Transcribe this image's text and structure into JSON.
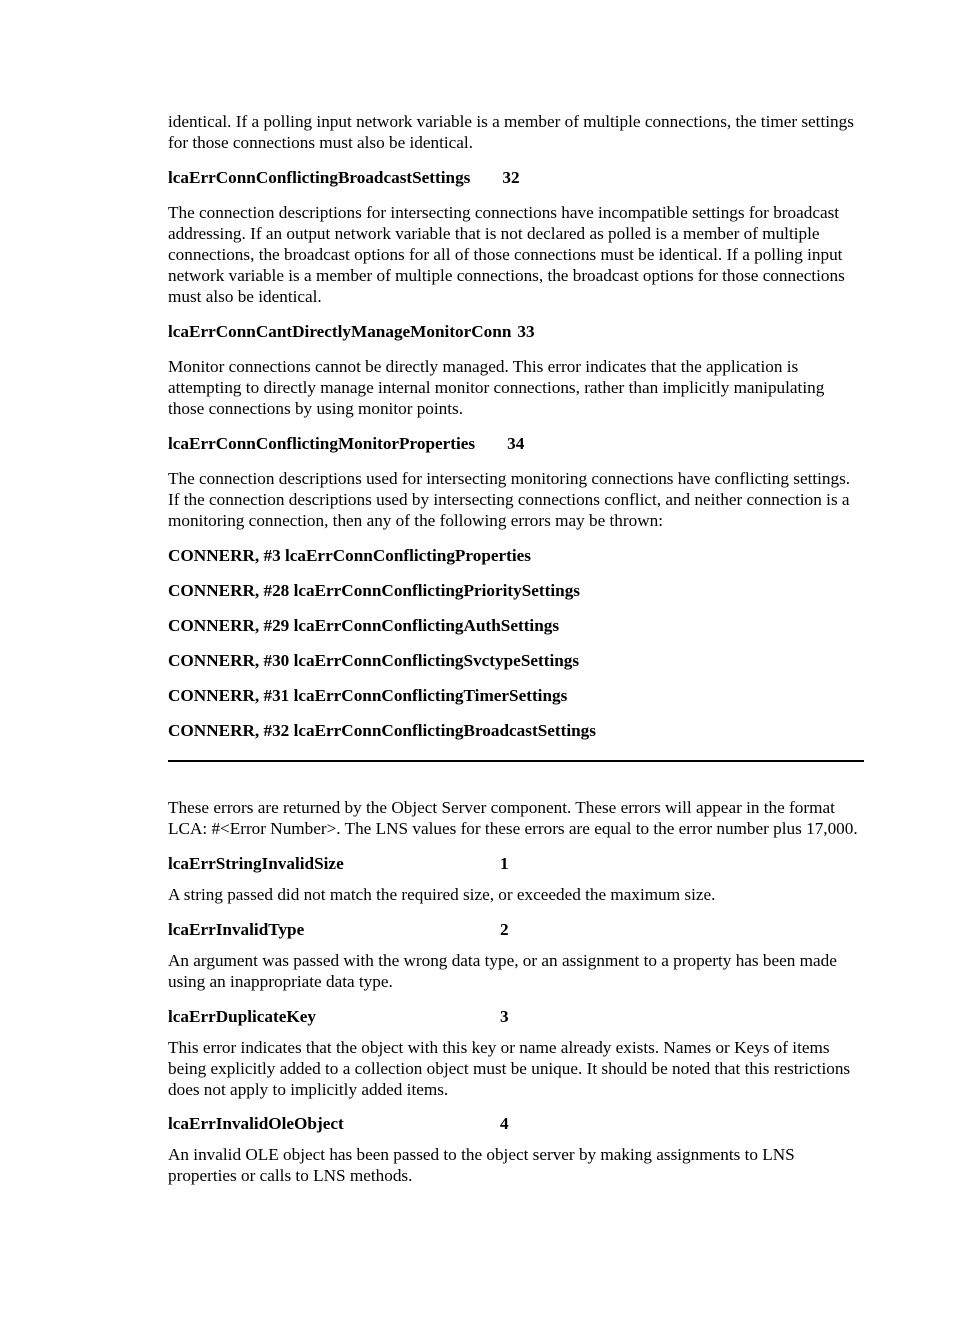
{
  "top": {
    "p1": "identical.  If a polling input network variable is a member of multiple connections, the timer settings for those connections must also be identical.",
    "h1_label": "lcaErrConnConflictingBroadcastSettings",
    "h1_num": "32",
    "p2": "The connection descriptions for intersecting connections have incompatible settings for broadcast addressing.  If an output network variable that is not declared as polled is a member of multiple connections, the broadcast options for all of those connections must be identical.  If a polling input network variable is a member of multiple connections, the broadcast options for those connections must also be identical.",
    "h2_label": "lcaErrConnCantDirectlyManageMonitorConn",
    "h2_num": "33",
    "p3": "Monitor connections cannot be directly managed.  This error indicates that the application is attempting to directly manage internal monitor connections, rather than implicitly manipulating those connections by using monitor points.",
    "h3_label": "lcaErrConnConflictingMonitorProperties",
    "h3_num": "34",
    "p4": "The connection descriptions used for intersecting monitoring connections have conflicting settings. If the connection descriptions used by intersecting connections conflict, and neither connection is a monitoring connection, then any of the following errors may be thrown:",
    "list": [
      "CONNERR, #3 lcaErrConnConflictingProperties",
      "CONNERR, #28 lcaErrConnConflictingPrioritySettings",
      "CONNERR, #29 lcaErrConnConflictingAuthSettings",
      "CONNERR, #30 lcaErrConnConflictingSvctypeSettings",
      "CONNERR, #31 lcaErrConnConflictingTimerSettings",
      "CONNERR, #32 lcaErrConnConflictingBroadcastSettings"
    ]
  },
  "bottom": {
    "intro": "These errors are returned by the Object Server component. These errors will appear in the format LCA: #<Error Number>. The LNS values for these errors are equal to the error number plus 17,000.",
    "items": [
      {
        "label": "lcaErrStringInvalidSize",
        "num": "1",
        "desc": "A string passed did not match the required size, or exceeded the maximum size."
      },
      {
        "label": "lcaErrInvalidType",
        "num": "2",
        "desc": "An argument was passed with the wrong data type, or an assignment to a property has been made using an inappropriate data type."
      },
      {
        "label": "lcaErrDuplicateKey",
        "num": "3",
        "desc": "This error indicates that the object with this key or name already exists. Names or Keys of items being explicitly added to a collection object must be unique. It should be noted that this restrictions does not apply to implicitly added items."
      },
      {
        "label": "lcaErrInvalidOleObject",
        "num": "4",
        "desc": "An invalid OLE object has been passed to the object server by making assignments to LNS properties or calls to LNS methods."
      }
    ]
  }
}
